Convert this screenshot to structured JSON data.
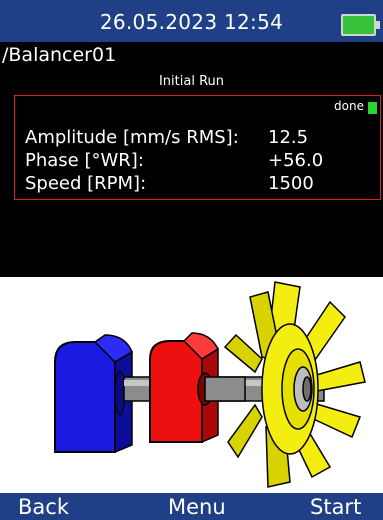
{
  "status": {
    "datetime": "26.05.2023 12:54",
    "battery_color": "#36c23a"
  },
  "path": "/Balancer01",
  "run_title": "Initial Run",
  "panel": {
    "status": "done",
    "rows": [
      {
        "label": "Amplitude [mm/s RMS]:",
        "value": "12.5"
      },
      {
        "label": "Phase [°WR]:",
        "value": "+56.0"
      },
      {
        "label": "Speed [RPM]:",
        "value": "1500"
      }
    ]
  },
  "softkeys": {
    "left": "Back",
    "middle": "Menu",
    "right": "Start"
  },
  "colors": {
    "bar": "#1f3f86",
    "frame": "#e02020",
    "motor": "#1a1ae0",
    "bearing": "#ee1010",
    "fan": "#f4ee10"
  }
}
